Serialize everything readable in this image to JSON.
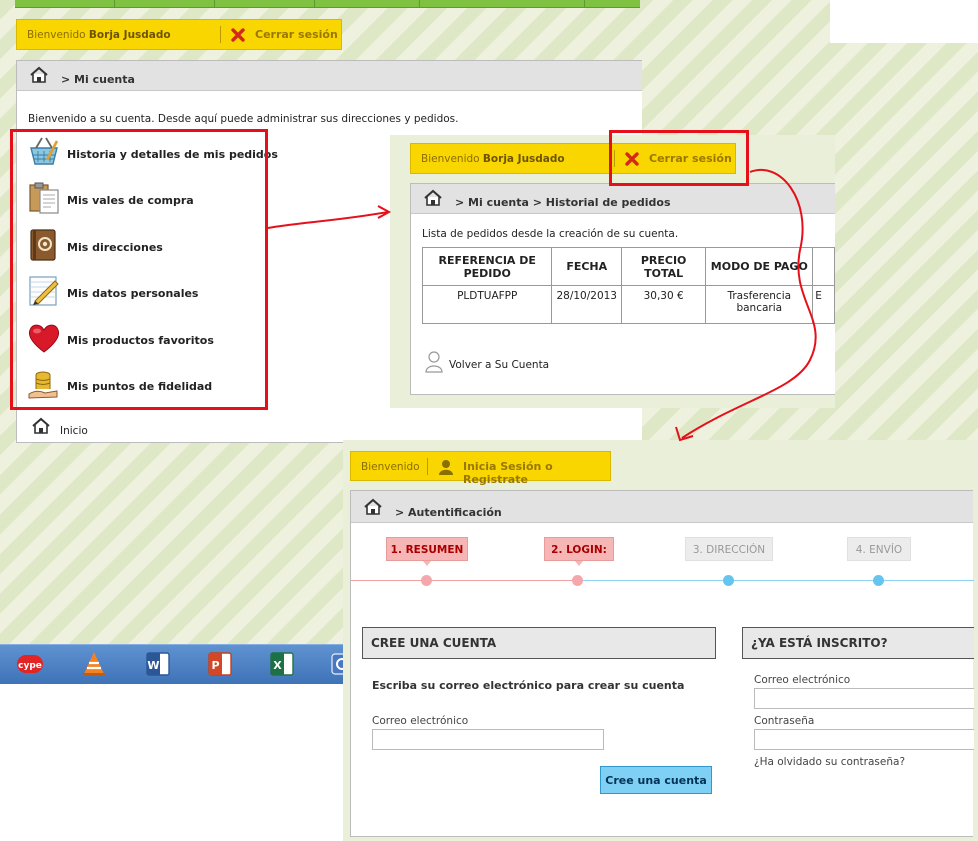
{
  "screen1": {
    "welcome_prefix": "Bienvenido",
    "user_name": "Borja Jusdado",
    "logout_label": "Cerrar sesión",
    "breadcrumb": "> Mi cuenta",
    "intro": "Bienvenido a su cuenta. Desde aquí puede administrar sus direcciones y pedidos.",
    "menu": [
      {
        "label": "Historia y detalles de mis pedidos",
        "icon": "shopping-basket-icon"
      },
      {
        "label": "Mis vales de compra",
        "icon": "vouchers-icon"
      },
      {
        "label": "Mis direcciones",
        "icon": "address-book-icon"
      },
      {
        "label": "Mis datos personales",
        "icon": "notepad-pencil-icon"
      },
      {
        "label": "Mis productos favoritos",
        "icon": "heart-icon"
      },
      {
        "label": "Mis puntos de fidelidad",
        "icon": "coins-icon"
      }
    ],
    "home_link": "Inicio"
  },
  "screen2": {
    "welcome_prefix": "Bienvenido",
    "user_name": "Borja Jusdado",
    "logout_label": "Cerrar sesión",
    "breadcrumb_root": "> Mi cuenta",
    "breadcrumb_current": "> Historial de pedidos",
    "intro": "Lista de pedidos desde la creación de su cuenta.",
    "table": {
      "headers": [
        "REFERENCIA DE PEDIDO",
        "FECHA",
        "PRECIO TOTAL",
        "MODO DE PAGO",
        "E"
      ],
      "rows": [
        [
          "PLDTUAFPP",
          "28/10/2013",
          "30,30 €",
          "Trasferencia bancaria",
          "E"
        ]
      ]
    },
    "back_link": "Volver a Su Cuenta"
  },
  "screen3": {
    "welcome_prefix": "Bienvenido",
    "login_label": "Inicia Sesión o Registrate",
    "breadcrumb": "> Autentificación",
    "steps": [
      {
        "label": "1. RESUMEN",
        "active": true
      },
      {
        "label": "2. LOGIN:",
        "active": true
      },
      {
        "label": "3. DIRECCIÓN",
        "active": false
      },
      {
        "label": "4. ENVÍO",
        "active": false
      }
    ],
    "create": {
      "title": "CREE UNA CUENTA",
      "instructions": "Escriba su correo electrónico para crear su cuenta",
      "email_label": "Correo electrónico",
      "email_value": "",
      "button": "Cree una cuenta"
    },
    "login": {
      "title": "¿YA ESTÁ INSCRITO?",
      "email_label": "Correo electrónico",
      "email_value": "",
      "password_label": "Contraseña",
      "password_value": "",
      "forgot": "¿Ha olvidado su contraseña?"
    }
  },
  "taskbar_icons": [
    "cype-icon",
    "vlc-icon",
    "word-icon",
    "powerpoint-icon",
    "excel-icon",
    "app-icon"
  ],
  "colors": {
    "accent_yellow": "#f9d600",
    "annotation_red": "#e5101a",
    "step_active": "#f7b6b6",
    "button_blue": "#7fd0f5"
  }
}
